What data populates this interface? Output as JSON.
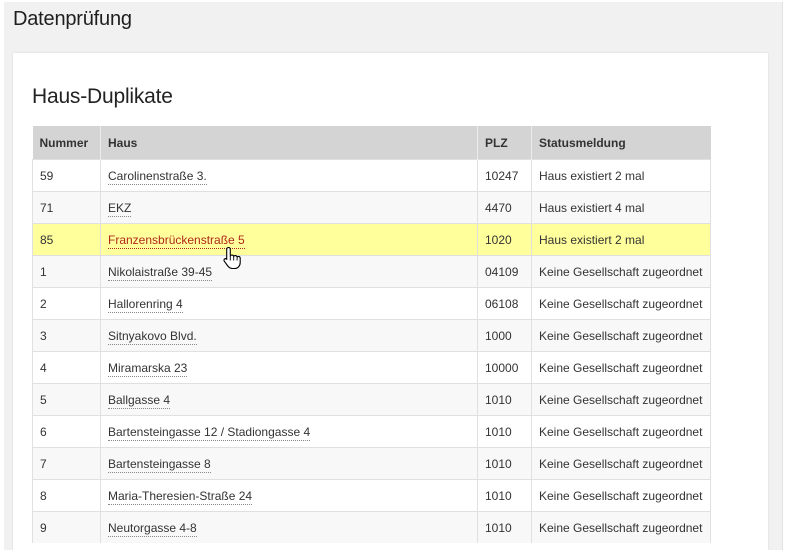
{
  "page": {
    "title": "Datenprüfung"
  },
  "panel": {
    "title": "Haus-Duplikate"
  },
  "table": {
    "headers": {
      "nummer": "Nummer",
      "haus": "Haus",
      "plz": "PLZ",
      "status": "Statusmeldung"
    },
    "rows": [
      {
        "nummer": "59",
        "haus": "Carolinenstraße 3.",
        "plz": "10247",
        "status": "Haus existiert 2 mal"
      },
      {
        "nummer": "71",
        "haus": "EKZ",
        "plz": "4470",
        "status": "Haus existiert 4 mal"
      },
      {
        "nummer": "85",
        "haus": "Franzensbrückenstraße 5",
        "plz": "1020",
        "status": "Haus existiert 2 mal"
      },
      {
        "nummer": "1",
        "haus": "Nikolaistraße 39-45",
        "plz": "04109",
        "status": "Keine Gesellschaft zugeordnet"
      },
      {
        "nummer": "2",
        "haus": "Hallorenring 4",
        "plz": "06108",
        "status": "Keine Gesellschaft zugeordnet"
      },
      {
        "nummer": "3",
        "haus": "Sitnyakovo Blvd.",
        "plz": "1000",
        "status": "Keine Gesellschaft zugeordnet"
      },
      {
        "nummer": "4",
        "haus": "Miramarska 23",
        "plz": "10000",
        "status": "Keine Gesellschaft zugeordnet"
      },
      {
        "nummer": "5",
        "haus": "Ballgasse 4",
        "plz": "1010",
        "status": "Keine Gesellschaft zugeordnet"
      },
      {
        "nummer": "6",
        "haus": "Bartensteingasse 12 / Stadiongasse 4",
        "plz": "1010",
        "status": "Keine Gesellschaft zugeordnet"
      },
      {
        "nummer": "7",
        "haus": "Bartensteingasse 8",
        "plz": "1010",
        "status": "Keine Gesellschaft zugeordnet"
      },
      {
        "nummer": "8",
        "haus": "Maria-Theresien-Straße 24",
        "plz": "1010",
        "status": "Keine Gesellschaft zugeordnet"
      },
      {
        "nummer": "9",
        "haus": "Neutorgasse 4-8",
        "plz": "1010",
        "status": "Keine Gesellschaft zugeordnet"
      }
    ],
    "hovered_row": 2
  },
  "icons": {
    "cursor": "hand-pointer-icon"
  },
  "colors": {
    "highlight_row": "#ffff9c",
    "link_hover": "#b0281c",
    "header_bg": "#d4d4d4"
  }
}
